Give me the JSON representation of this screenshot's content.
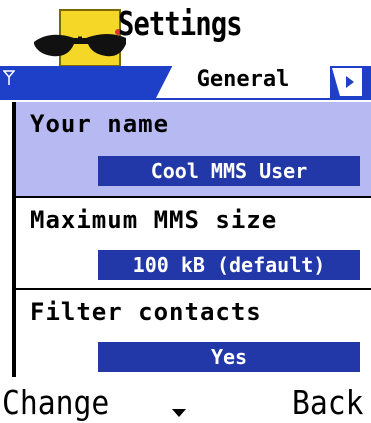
{
  "header": {
    "title": "Settings",
    "icon": "sunglasses-app-icon"
  },
  "tabs": {
    "active_label": "General",
    "indicator_icon": "signal-icon",
    "next_icon": "right-arrow-icon"
  },
  "settings": [
    {
      "label": "Your name",
      "value": "Cool MMS User",
      "selected": true
    },
    {
      "label": "Maximum MMS size",
      "value": "100 kB (default)",
      "selected": false
    },
    {
      "label": "Filter contacts",
      "value": "Yes",
      "selected": false
    }
  ],
  "softkeys": {
    "left": "Change",
    "middle_icon": "down-arrow-icon",
    "right": "Back"
  },
  "colors": {
    "tab_bar": "#1e3fc8",
    "selection": "#b7b9f3",
    "value_box": "#2237a8",
    "icon_yellow": "#f5d728"
  }
}
